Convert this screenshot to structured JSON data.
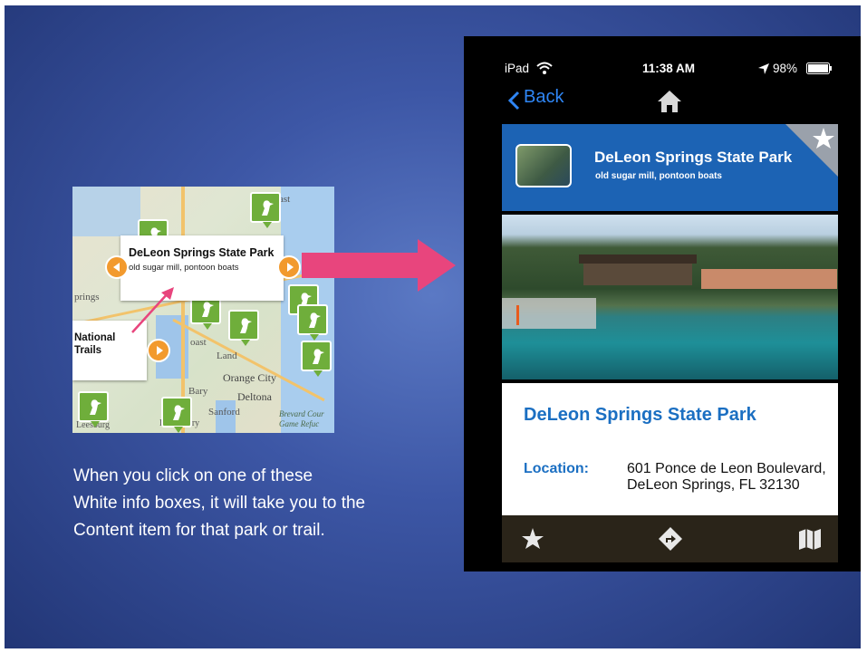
{
  "map": {
    "infobox_title": "DeLeon Springs State Park",
    "infobox_subtitle": "old sugar mill, pontoon boats",
    "trail_box_line1": "National",
    "trail_box_line2": "Trails",
    "labels": [
      "ast",
      "prings",
      "oast",
      "Land",
      "Orange City",
      "Bary",
      "Deltona",
      "Sanford",
      "Lake Mary",
      "Leesburg",
      "Brevard Cour",
      "Game Refuc"
    ]
  },
  "caption": {
    "lines": [
      "When you click on one of these",
      "White info boxes, it will take you to the",
      "Content item for that park or trail."
    ]
  },
  "phone": {
    "status": {
      "device": "iPad",
      "time": "11:38 AM",
      "battery": "98%"
    },
    "nav": {
      "back_label": "Back"
    },
    "header": {
      "title": "DeLeon Springs State Park",
      "subtitle": "old sugar mill, pontoon boats"
    },
    "content": {
      "title": "DeLeon Springs State Park",
      "location_label": "Location:",
      "location_value": "601 Ponce de Leon Boulevard, DeLeon Springs, FL 32130"
    },
    "tabbar": [
      "star-icon",
      "directions-icon",
      "map-icon"
    ]
  },
  "colors": {
    "accent": "#1b6fc2",
    "arrow": "#e8457d",
    "pin": "#6fae3b",
    "ios_blue": "#2f86f5"
  }
}
